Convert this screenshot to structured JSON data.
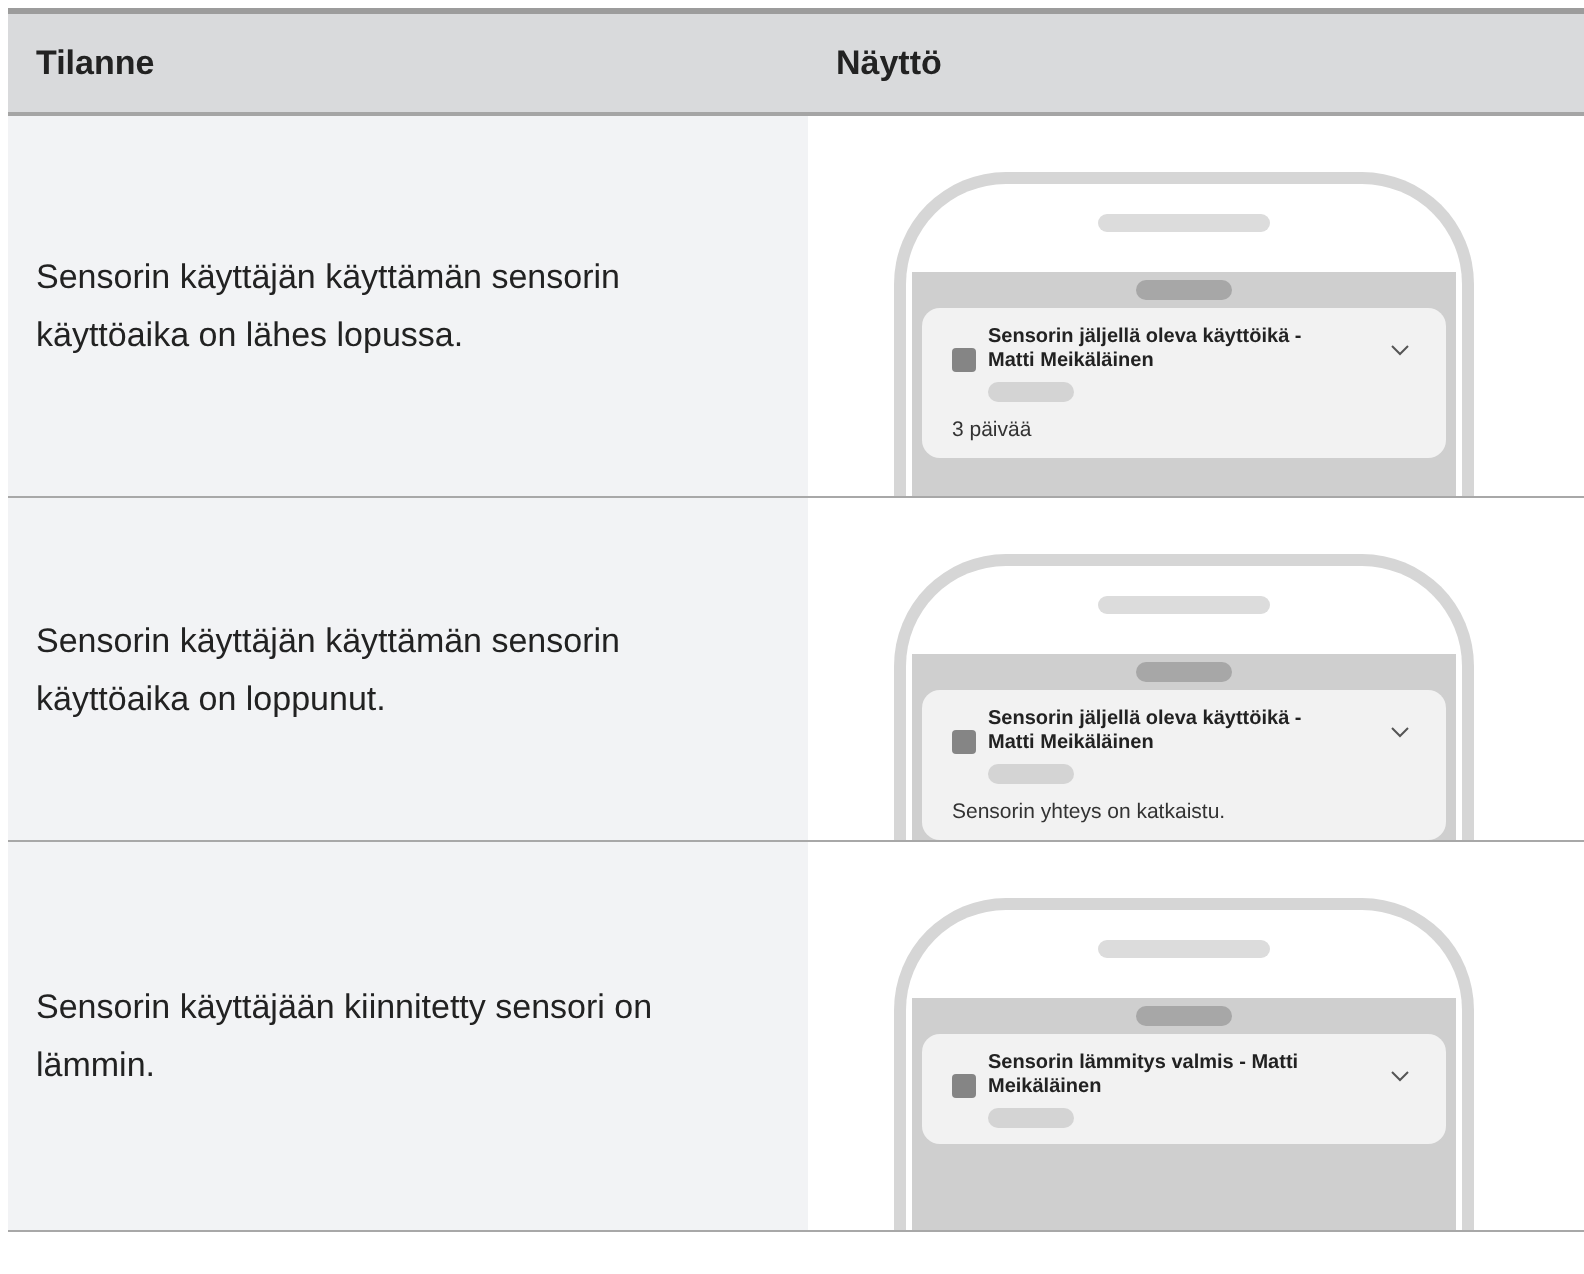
{
  "table": {
    "columns": [
      "Tilanne",
      "Näyttö"
    ],
    "rows": [
      {
        "situation": "Sensorin käyttäjän käyttämän sensorin käyttöaika on lähes lopussa.",
        "notification": {
          "title": "Sensorin jäljellä oleva käyttöikä - Matti Meikäläinen",
          "body": "3 päivää"
        }
      },
      {
        "situation": "Sensorin käyttäjän käyttämän sensorin käyttöaika on loppunut.",
        "notification": {
          "title": "Sensorin jäljellä oleva käyttöikä - Matti Meikäläinen",
          "body": "Sensorin yhteys on katkaistu."
        }
      },
      {
        "situation": "Sensorin käyttäjään kiinnitetty sensori on lämmin.",
        "notification": {
          "title": "Sensorin lämmitys valmis - Matti Meikäläinen"
        }
      }
    ]
  }
}
